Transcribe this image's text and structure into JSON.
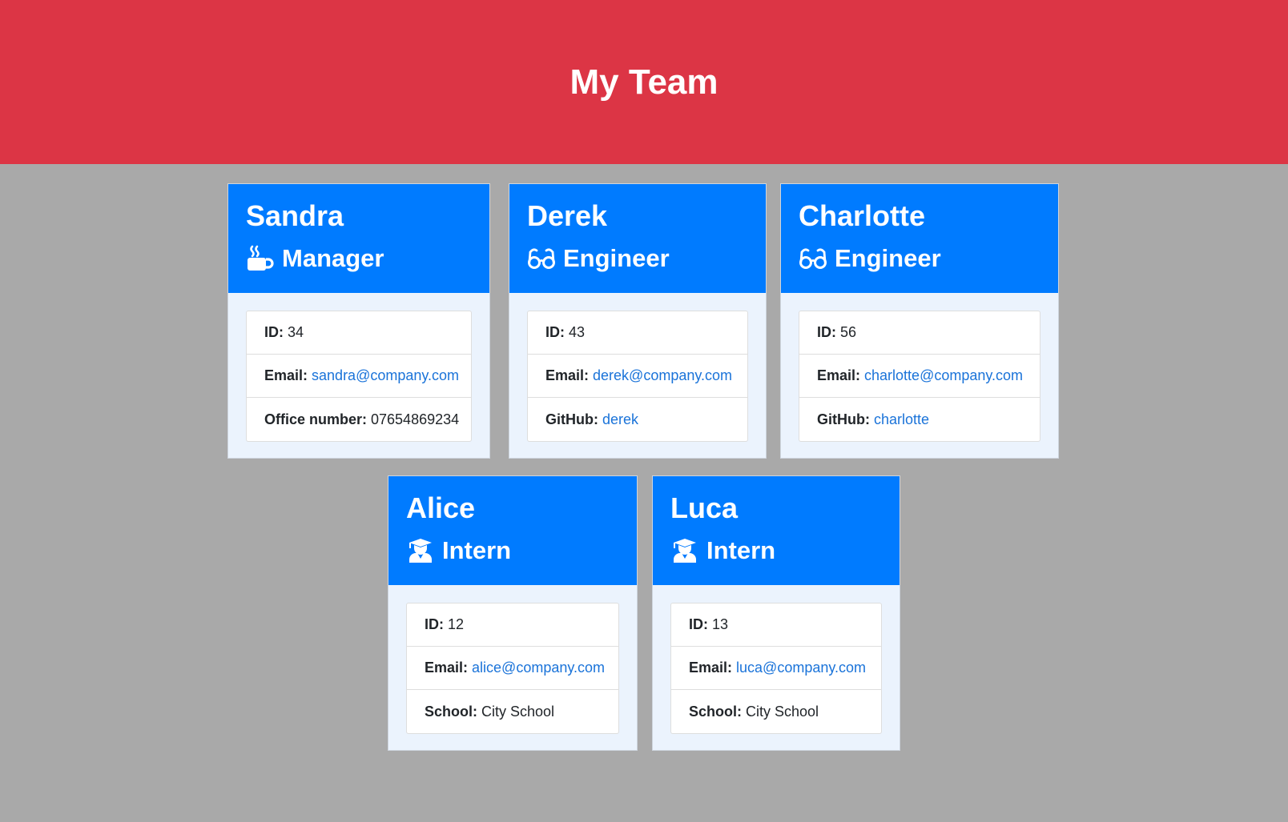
{
  "header": {
    "title": "My Team"
  },
  "labels": {
    "id": "ID:",
    "email": "Email:",
    "office": "Office number:",
    "github": "GitHub:",
    "school": "School:"
  },
  "icons": {
    "manager": "mug-hot-icon",
    "engineer": "glasses-icon",
    "intern": "user-graduate-icon"
  },
  "colors": {
    "header_bg": "#dc3545",
    "card_header_bg": "#007bff",
    "page_bg": "#a9a9a9",
    "link": "#1a73d9"
  },
  "team": [
    {
      "name": "Sandra",
      "role": "Manager",
      "id": "34",
      "email": "sandra@company.com",
      "office_number": "07654869234"
    },
    {
      "name": "Derek",
      "role": "Engineer",
      "id": "43",
      "email": "derek@company.com",
      "github": "derek"
    },
    {
      "name": "Charlotte",
      "role": "Engineer",
      "id": "56",
      "email": "charlotte@company.com",
      "github": "charlotte"
    },
    {
      "name": "Alice",
      "role": "Intern",
      "id": "12",
      "email": "alice@company.com",
      "school": "City School"
    },
    {
      "name": "Luca",
      "role": "Intern",
      "id": "13",
      "email": "luca@company.com",
      "school": "City School"
    }
  ]
}
